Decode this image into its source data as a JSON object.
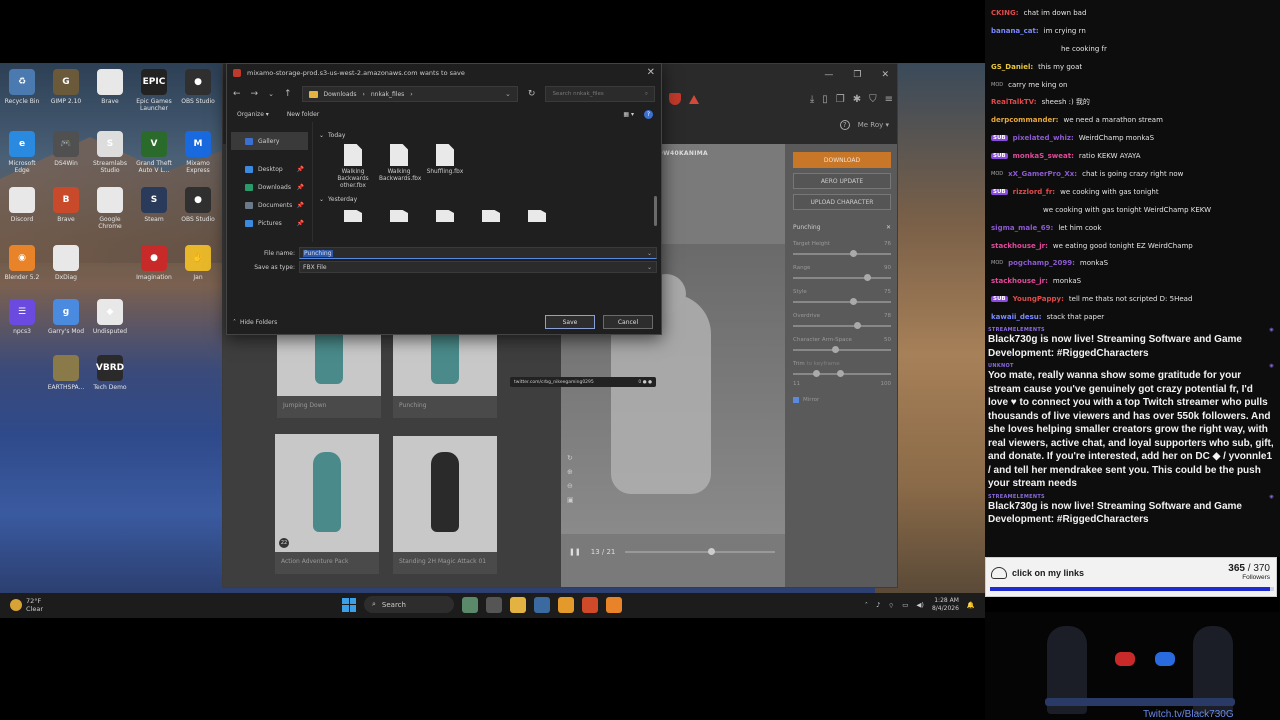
{
  "desktop": {
    "icons": [
      {
        "label": "Recycle Bin",
        "color": "#4a7ab0",
        "glyph": "♻"
      },
      {
        "label": "GIMP 2.10",
        "color": "#6a5a3a",
        "glyph": "G"
      },
      {
        "label": "Brave",
        "color": "#e8e8e8",
        "glyph": ""
      },
      {
        "label": "Epic Games Launcher",
        "color": "#222222",
        "glyph": "EPIC"
      },
      {
        "label": "OBS Studio",
        "color": "#303030",
        "glyph": "●"
      },
      {
        "label": "Microsoft Edge",
        "color": "#2a8adf",
        "glyph": "e"
      },
      {
        "label": "DS4Win",
        "color": "#505050",
        "glyph": "🎮"
      },
      {
        "label": "Streamlabs Studio",
        "color": "#ddd",
        "glyph": "S"
      },
      {
        "label": "Grand Theft Auto V L...",
        "color": "#2a6a2a",
        "glyph": "V"
      },
      {
        "label": "Mixamo Express",
        "color": "#1a6adf",
        "glyph": "M"
      },
      {
        "label": "Discord",
        "color": "#e8e8e8",
        "glyph": ""
      },
      {
        "label": "Brave",
        "color": "#c84a2a",
        "glyph": "B"
      },
      {
        "label": "Google Chrome",
        "color": "#e8e8e8",
        "glyph": ""
      },
      {
        "label": "Steam",
        "color": "#2a3a5a",
        "glyph": "S"
      },
      {
        "label": "OBS Studio",
        "color": "#303030",
        "glyph": "●"
      },
      {
        "label": "Blender 5.2",
        "color": "#e8832a",
        "glyph": "◉"
      },
      {
        "label": "DxDiag",
        "color": "#e8e8e8",
        "glyph": ""
      },
      {
        "label": "Imagination",
        "color": "#c82a2a",
        "glyph": "●"
      },
      {
        "label": "Jan",
        "color": "#e8b82a",
        "glyph": "✋"
      },
      {
        "label": "npcs3",
        "color": "#6a4adf",
        "glyph": "☰"
      },
      {
        "label": "Garry's Mod",
        "color": "#4a8adf",
        "glyph": "g"
      },
      {
        "label": "Undisputed",
        "color": "#e8e8e8",
        "glyph": "◆"
      },
      {
        "label": "EARTHSPA...",
        "color": "#8a7a4a",
        "glyph": ""
      },
      {
        "label": "Tech Demo",
        "color": "#2a2a2a",
        "glyph": "VBRD"
      }
    ]
  },
  "browser": {
    "window_controls": [
      "—",
      "❐",
      "✕"
    ],
    "toolbar_icons": [
      "download-icon",
      "sidebar-icon",
      "copy-icon",
      "extensions-icon",
      "shield-icon",
      "menu-icon"
    ],
    "user": "Me Roy",
    "viewer_title": "PUNCHING ON HENNYLOW40KANIMA",
    "left_cards": [
      {
        "label": "Jumping Down"
      },
      {
        "label": "Punching"
      },
      {
        "label": "Action Adventure Pack"
      },
      {
        "label": "Standing 2H Magic Attack 01"
      }
    ],
    "card_badge": "22",
    "timeline": {
      "frame": "13 / 21",
      "progress": 0.55
    },
    "url_tooltip": "twitter.com/crbg_nikeegaming0295",
    "url_tooltip_right": "0 ● ●",
    "right_panel": {
      "download": "DOWNLOAD",
      "aero": "AERO UPDATE",
      "upload": "UPLOAD CHARACTER",
      "anim_name": "Punching",
      "sliders": [
        {
          "label": "Target Height",
          "value": "76",
          "pos": 0.58
        },
        {
          "label": "Range",
          "value": "90",
          "pos": 0.72
        },
        {
          "label": "Style",
          "value": "75",
          "pos": 0.58
        },
        {
          "label": "Overdrive",
          "value": "78",
          "pos": 0.62
        },
        {
          "label": "Character Arm-Space",
          "value": "50",
          "pos": 0.4
        }
      ],
      "trim_label": "Trim",
      "trim_sub": "to keyframe",
      "trim_min": "11",
      "trim_max": "100",
      "mirror": "Mirror"
    }
  },
  "dialog": {
    "title": "mixamo-storage-prod.s3-us-west-2.amazonaws.com wants to save",
    "path": [
      "Downloads",
      "nnkak_files"
    ],
    "search_placeholder": "Search nnkak_files",
    "organize": "Organize ▾",
    "new_folder": "New folder",
    "sidebar": [
      {
        "label": "Gallery",
        "color": "#3b6fd0"
      },
      {
        "label": "Desktop",
        "color": "#3b8adf"
      },
      {
        "label": "Downloads",
        "color": "#2a9a6a"
      },
      {
        "label": "Documents",
        "color": "#6a7a8a"
      },
      {
        "label": "Pictures",
        "color": "#3b8adf"
      }
    ],
    "group_today": "Today",
    "group_yesterday": "Yesterday",
    "files_today": [
      {
        "name": "Walking Backwards other.fbx"
      },
      {
        "name": "Walking Backwards.fbx"
      },
      {
        "name": "Shuffling.fbx"
      }
    ],
    "file_name_label": "File name:",
    "file_name_value": "Punching",
    "save_type_label": "Save as type:",
    "save_type_value": "FBX File",
    "hide_folders": "Hide Folders",
    "save": "Save",
    "cancel": "Cancel"
  },
  "taskbar": {
    "temp": "72°F",
    "weather": "Clear",
    "search": "Search",
    "time": "1:28 AM",
    "date": "8/4/2026",
    "apps": [
      {
        "name": "file-explorer",
        "color": "#e3b341"
      },
      {
        "name": "steam",
        "color": "#3a6aa0"
      },
      {
        "name": "streamer-app",
        "color": "#e39a2a"
      },
      {
        "name": "brave",
        "color": "#d04a2a"
      },
      {
        "name": "blender",
        "color": "#e8832a"
      }
    ]
  },
  "chat": {
    "messages": [
      {
        "user": "CKING:",
        "color": "#e04a4a",
        "text": "chat im down bad",
        "badge": ""
      },
      {
        "user": "banana_cat:",
        "color": "#7a8aff",
        "text": "im crying rn",
        "badge": ""
      },
      {
        "user": "",
        "color": "#fff",
        "text": "he cooking fr",
        "badge": "",
        "indent": 70
      },
      {
        "user": "GS_Daniel:",
        "color": "#e8c83a",
        "text": "this my goat",
        "badge": ""
      },
      {
        "user": "",
        "color": "#fff",
        "text": "carry me king on",
        "badge": "MOD",
        "indent": 0
      },
      {
        "user": "RealTalkTV:",
        "color": "#e04a4a",
        "text": "sheesh :) 我的",
        "badge": ""
      },
      {
        "user": "derpcommander:",
        "color": "#e8a83a",
        "text": "we need a marathon stream",
        "badge": ""
      },
      {
        "user": "pixelated_whiz:",
        "color": "#8a5acf",
        "text": "WeirdChamp monkaS",
        "badge": "SUB"
      },
      {
        "user": "monkaS_sweat:",
        "color": "#e04a9a",
        "text": "ratio KEKW AYAYA",
        "badge": "SUB"
      },
      {
        "user": "xX_GamerPro_Xx:",
        "color": "#8a5acf",
        "text": "chat is going crazy right now",
        "badge": "MOD"
      },
      {
        "user": "rizzlord_fr:",
        "color": "#e04a4a",
        "text": "we cooking with gas tonight",
        "badge": "SUB"
      },
      {
        "user": "",
        "color": "#fff",
        "text": "we cooking with gas tonight WeirdChamp KEKW",
        "badge": "",
        "indent": 52
      },
      {
        "user": "sigma_male_69:",
        "color": "#8a5acf",
        "text": "let him cook",
        "badge": ""
      },
      {
        "user": "stackhouse_jr:",
        "color": "#e04a9a",
        "text": "we eating good tonight EZ WeirdChamp",
        "badge": ""
      },
      {
        "user": "pogchamp_2099:",
        "color": "#8a5acf",
        "text": "monkaS",
        "badge": "MOD"
      },
      {
        "user": "stackhouse_jr:",
        "color": "#e04a9a",
        "text": "monkaS",
        "badge": ""
      },
      {
        "user": "YoungPappy:",
        "color": "#e04a4a",
        "text": "tell me thats not scripted D: 5Head",
        "badge": "SUB"
      },
      {
        "user": "kawaii_desu:",
        "color": "#7a8aff",
        "text": "stack that paper",
        "badge": ""
      }
    ],
    "events": [
      {
        "head": "STREAMELEMENTS",
        "text": "Black730g is now live! Streaming Software and Game Development: #RiggedCharacters"
      },
      {
        "head": "UNKNOT",
        "text": "Yoo mate, really wanna show some gratitude for your stream cause you've genuinely got crazy potential fr, I'd love ♥ to connect you with a top Twitch streamer who pulls thousands of live viewers and has over 550k followers. And she loves helping smaller creators grow the right way, with real viewers, active chat, and loyal supporters who sub, gift, and donate. If you're interested, add her on DC ◆ / yvonnle1 / and tell her mendrakee sent you. This could be the push your stream needs"
      },
      {
        "head": "STREAMELEMENTS",
        "text": "Black730g is now live! Streaming Software and Game Development: #RiggedCharacters"
      }
    ]
  },
  "follower_goal": {
    "label": "click on my links",
    "current": "365",
    "target": "370",
    "sublabel": "Followers",
    "progress": 0.986
  },
  "cam": {
    "link": "Twitch.tv/Black730G"
  }
}
